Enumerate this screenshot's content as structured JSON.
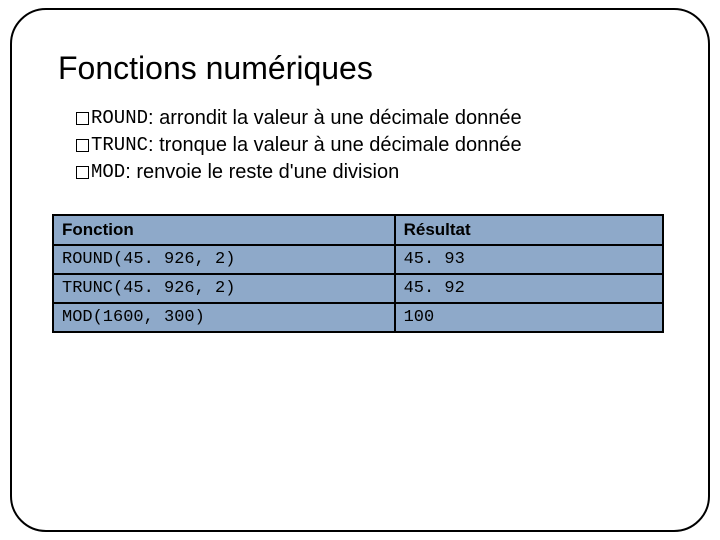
{
  "title": "Fonctions numériques",
  "bullets": [
    {
      "code": "ROUND",
      "text": " : arrondit la valeur à une décimale donnée"
    },
    {
      "code": "TRUNC",
      "text": " : tronque la valeur à une décimale donnée"
    },
    {
      "code": "MOD",
      "text": " : renvoie le reste d'une division"
    }
  ],
  "table": {
    "headers": {
      "func": "Fonction",
      "result": "Résultat"
    },
    "rows": [
      {
        "func": "ROUND(45. 926, 2)",
        "result": "45. 93"
      },
      {
        "func": "TRUNC(45. 926, 2)",
        "result": "45. 92"
      },
      {
        "func": "MOD(1600, 300)",
        "result": "100"
      }
    ]
  }
}
